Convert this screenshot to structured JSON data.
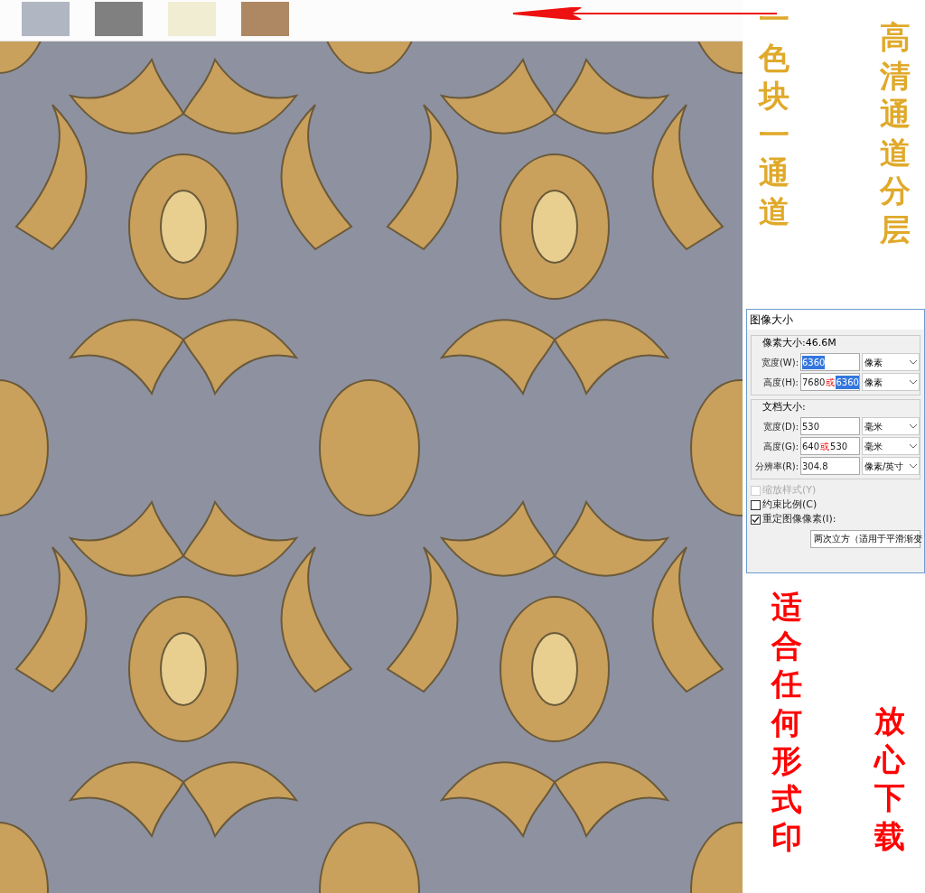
{
  "swatches": [
    {
      "color": "#b1b6c3"
    },
    {
      "color": "#808080"
    },
    {
      "color": "#f1edd3"
    },
    {
      "color": "#ae8763"
    }
  ],
  "captions_top": [
    {
      "text": "一色块一通道",
      "color": "#e0a92a"
    },
    {
      "text": "高清通道分层",
      "color": "#e0a92a"
    }
  ],
  "dialog": {
    "title": "图像大小",
    "pixel_group": {
      "label": "像素大小:46.6M",
      "rows": [
        {
          "label": "宽度(W):",
          "value": "6360",
          "selected": true,
          "unit": "像素"
        },
        {
          "label": "高度(H):",
          "value": "7680",
          "mark": "或",
          "alt_value": "6360",
          "selected": true,
          "unit": "像素"
        }
      ]
    },
    "doc_group": {
      "label": "文档大小:",
      "rows": [
        {
          "label": "宽度(D):",
          "value": "530",
          "unit": "毫米"
        },
        {
          "label": "高度(G):",
          "value": "640",
          "mark": "或",
          "alt_value": "530",
          "unit": "毫米"
        },
        {
          "label": "分辨率(R):",
          "value": "304.8",
          "unit": "像素/英寸"
        }
      ]
    },
    "checks": [
      {
        "label": "缩放样式(Y)",
        "checked": false,
        "disabled": true
      },
      {
        "label": "约束比例(C)",
        "checked": false,
        "disabled": false
      },
      {
        "label": "重定图像像素(I):",
        "checked": true,
        "disabled": false
      }
    ],
    "method": "两次立方（适用于平滑渐变"
  },
  "captions_bottom": [
    {
      "text": "适合任何形式印",
      "color": "#ff0000"
    },
    {
      "text": "放心下载",
      "color": "#ff0000"
    }
  ]
}
